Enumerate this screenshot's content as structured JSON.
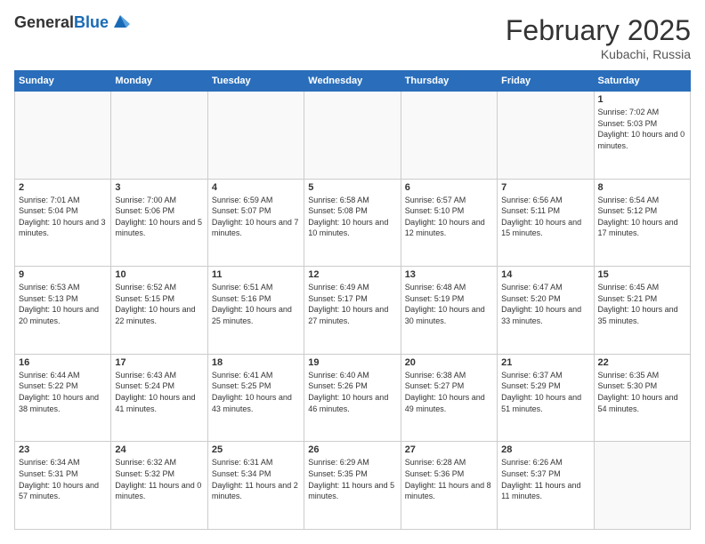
{
  "header": {
    "logo_general": "General",
    "logo_blue": "Blue",
    "month_title": "February 2025",
    "location": "Kubachi, Russia"
  },
  "weekdays": [
    "Sunday",
    "Monday",
    "Tuesday",
    "Wednesday",
    "Thursday",
    "Friday",
    "Saturday"
  ],
  "weeks": [
    [
      {
        "day": "",
        "info": ""
      },
      {
        "day": "",
        "info": ""
      },
      {
        "day": "",
        "info": ""
      },
      {
        "day": "",
        "info": ""
      },
      {
        "day": "",
        "info": ""
      },
      {
        "day": "",
        "info": ""
      },
      {
        "day": "1",
        "info": "Sunrise: 7:02 AM\nSunset: 5:03 PM\nDaylight: 10 hours\nand 0 minutes."
      }
    ],
    [
      {
        "day": "2",
        "info": "Sunrise: 7:01 AM\nSunset: 5:04 PM\nDaylight: 10 hours\nand 3 minutes."
      },
      {
        "day": "3",
        "info": "Sunrise: 7:00 AM\nSunset: 5:06 PM\nDaylight: 10 hours\nand 5 minutes."
      },
      {
        "day": "4",
        "info": "Sunrise: 6:59 AM\nSunset: 5:07 PM\nDaylight: 10 hours\nand 7 minutes."
      },
      {
        "day": "5",
        "info": "Sunrise: 6:58 AM\nSunset: 5:08 PM\nDaylight: 10 hours\nand 10 minutes."
      },
      {
        "day": "6",
        "info": "Sunrise: 6:57 AM\nSunset: 5:10 PM\nDaylight: 10 hours\nand 12 minutes."
      },
      {
        "day": "7",
        "info": "Sunrise: 6:56 AM\nSunset: 5:11 PM\nDaylight: 10 hours\nand 15 minutes."
      },
      {
        "day": "8",
        "info": "Sunrise: 6:54 AM\nSunset: 5:12 PM\nDaylight: 10 hours\nand 17 minutes."
      }
    ],
    [
      {
        "day": "9",
        "info": "Sunrise: 6:53 AM\nSunset: 5:13 PM\nDaylight: 10 hours\nand 20 minutes."
      },
      {
        "day": "10",
        "info": "Sunrise: 6:52 AM\nSunset: 5:15 PM\nDaylight: 10 hours\nand 22 minutes."
      },
      {
        "day": "11",
        "info": "Sunrise: 6:51 AM\nSunset: 5:16 PM\nDaylight: 10 hours\nand 25 minutes."
      },
      {
        "day": "12",
        "info": "Sunrise: 6:49 AM\nSunset: 5:17 PM\nDaylight: 10 hours\nand 27 minutes."
      },
      {
        "day": "13",
        "info": "Sunrise: 6:48 AM\nSunset: 5:19 PM\nDaylight: 10 hours\nand 30 minutes."
      },
      {
        "day": "14",
        "info": "Sunrise: 6:47 AM\nSunset: 5:20 PM\nDaylight: 10 hours\nand 33 minutes."
      },
      {
        "day": "15",
        "info": "Sunrise: 6:45 AM\nSunset: 5:21 PM\nDaylight: 10 hours\nand 35 minutes."
      }
    ],
    [
      {
        "day": "16",
        "info": "Sunrise: 6:44 AM\nSunset: 5:22 PM\nDaylight: 10 hours\nand 38 minutes."
      },
      {
        "day": "17",
        "info": "Sunrise: 6:43 AM\nSunset: 5:24 PM\nDaylight: 10 hours\nand 41 minutes."
      },
      {
        "day": "18",
        "info": "Sunrise: 6:41 AM\nSunset: 5:25 PM\nDaylight: 10 hours\nand 43 minutes."
      },
      {
        "day": "19",
        "info": "Sunrise: 6:40 AM\nSunset: 5:26 PM\nDaylight: 10 hours\nand 46 minutes."
      },
      {
        "day": "20",
        "info": "Sunrise: 6:38 AM\nSunset: 5:27 PM\nDaylight: 10 hours\nand 49 minutes."
      },
      {
        "day": "21",
        "info": "Sunrise: 6:37 AM\nSunset: 5:29 PM\nDaylight: 10 hours\nand 51 minutes."
      },
      {
        "day": "22",
        "info": "Sunrise: 6:35 AM\nSunset: 5:30 PM\nDaylight: 10 hours\nand 54 minutes."
      }
    ],
    [
      {
        "day": "23",
        "info": "Sunrise: 6:34 AM\nSunset: 5:31 PM\nDaylight: 10 hours\nand 57 minutes."
      },
      {
        "day": "24",
        "info": "Sunrise: 6:32 AM\nSunset: 5:32 PM\nDaylight: 11 hours\nand 0 minutes."
      },
      {
        "day": "25",
        "info": "Sunrise: 6:31 AM\nSunset: 5:34 PM\nDaylight: 11 hours\nand 2 minutes."
      },
      {
        "day": "26",
        "info": "Sunrise: 6:29 AM\nSunset: 5:35 PM\nDaylight: 11 hours\nand 5 minutes."
      },
      {
        "day": "27",
        "info": "Sunrise: 6:28 AM\nSunset: 5:36 PM\nDaylight: 11 hours\nand 8 minutes."
      },
      {
        "day": "28",
        "info": "Sunrise: 6:26 AM\nSunset: 5:37 PM\nDaylight: 11 hours\nand 11 minutes."
      },
      {
        "day": "",
        "info": ""
      }
    ]
  ]
}
